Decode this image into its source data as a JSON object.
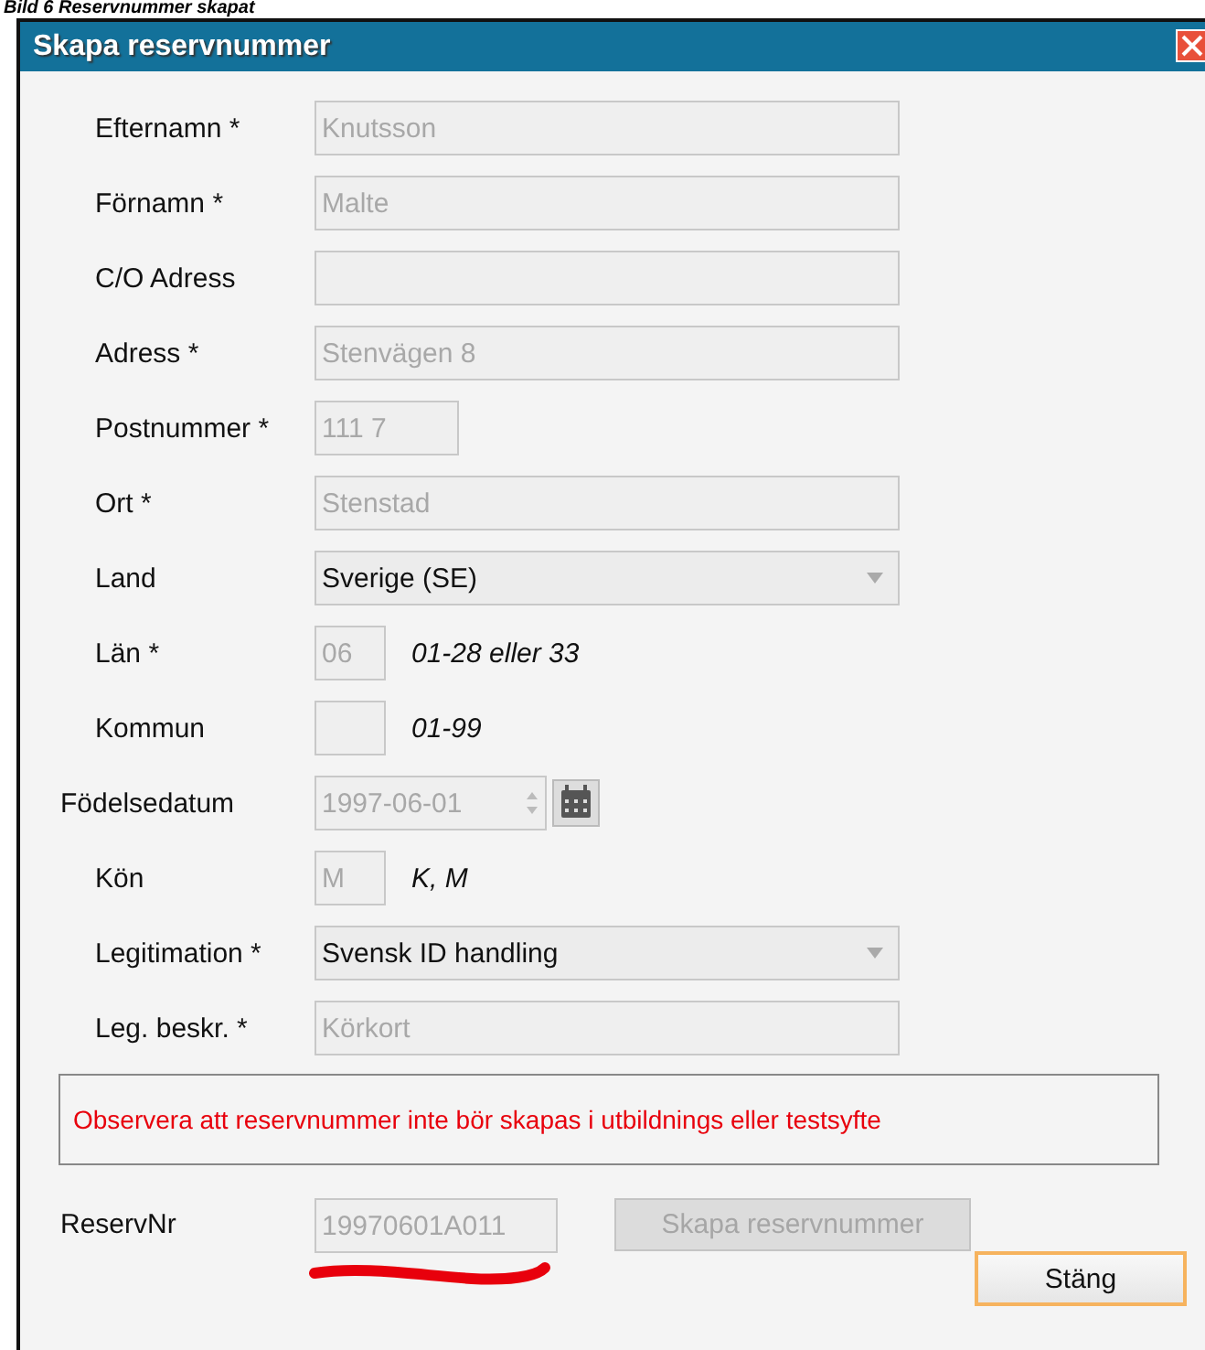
{
  "caption": "Bild 6 Reservnummer skapat",
  "window": {
    "title": "Skapa reservnummer"
  },
  "fields": [
    {
      "label": "Efternamn *",
      "kind": "text",
      "value": "Knutsson",
      "disabled": true
    },
    {
      "label": "Förnamn *",
      "kind": "text",
      "value": "Malte",
      "disabled": true
    },
    {
      "label": "C/O Adress",
      "kind": "text",
      "disabled": true
    },
    {
      "label": "Adress *",
      "kind": "text",
      "value": "Stenvägen 8",
      "disabled": true
    },
    {
      "label": "Postnummer *",
      "kind": "short",
      "value": "111 7",
      "disabled": true
    },
    {
      "label": "Ort *",
      "kind": "text",
      "value": "Stenstad",
      "disabled": true
    },
    {
      "label": "Land",
      "kind": "select",
      "value": "Sverige (SE)",
      "disabled": false
    },
    {
      "label": "Län *",
      "kind": "tiny",
      "value": "06",
      "hint": "01-28 eller 33",
      "disabled": true
    },
    {
      "label": "Kommun",
      "kind": "tiny",
      "hint": "01-99",
      "disabled": true
    },
    {
      "label": "Födelsedatum",
      "kind": "date",
      "value": "1997-06-01",
      "disabled": true
    },
    {
      "label": "Kön",
      "kind": "tiny",
      "value": "M",
      "hint": "K, M",
      "disabled": true
    },
    {
      "label": "Legitimation *",
      "kind": "select",
      "value": "Svensk ID handling",
      "disabled": false
    },
    {
      "label": "Leg. beskr. *",
      "kind": "text",
      "value": "Körkort",
      "disabled": true
    }
  ],
  "warning": "Observera att reservnummer inte bör skapas i utbildnings eller testsyfte",
  "reserv": {
    "label": "ReservNr",
    "value": "19970601A011",
    "disabled": true
  },
  "create_button": {
    "label": "Skapa reservnummer",
    "disabled": true
  },
  "close_button": {
    "label": "Stäng",
    "focused": true
  }
}
